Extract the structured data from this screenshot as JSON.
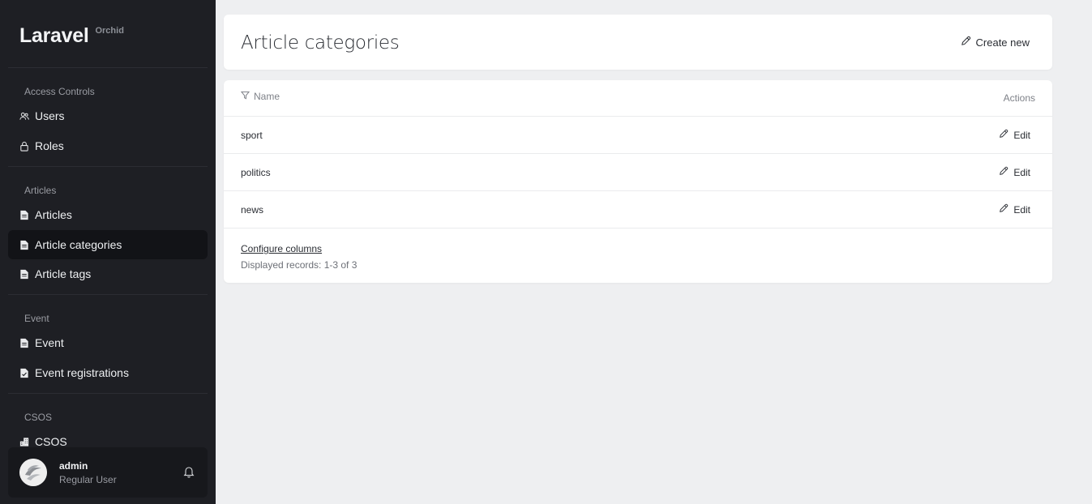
{
  "sidebar": {
    "brand": {
      "name": "Laravel",
      "sub": "Orchid"
    },
    "sections": [
      {
        "title": "Access Controls",
        "items": [
          {
            "label": "Users",
            "icon": "users-icon"
          },
          {
            "label": "Roles",
            "icon": "lock-icon"
          }
        ]
      },
      {
        "title": "Articles",
        "items": [
          {
            "label": "Articles",
            "icon": "document-icon"
          },
          {
            "label": "Article categories",
            "icon": "document-icon",
            "active": true
          },
          {
            "label": "Article tags",
            "icon": "document-icon"
          }
        ]
      },
      {
        "title": "Event",
        "items": [
          {
            "label": "Event",
            "icon": "document-icon"
          },
          {
            "label": "Event registrations",
            "icon": "document-check-icon"
          }
        ]
      },
      {
        "title": "CSOS",
        "items": [
          {
            "label": "CSOS",
            "icon": "building-icon"
          }
        ]
      }
    ],
    "user": {
      "name": "admin",
      "role": "Regular User"
    }
  },
  "header": {
    "title": "Article categories",
    "create_label": "Create new"
  },
  "table": {
    "columns": {
      "name": "Name",
      "actions": "Actions"
    },
    "rows": [
      {
        "name": "sport",
        "action": "Edit"
      },
      {
        "name": "politics",
        "action": "Edit"
      },
      {
        "name": "news",
        "action": "Edit"
      }
    ],
    "configure_label": "Configure columns",
    "records_label": "Displayed records: 1-3 of 3"
  },
  "colors": {
    "sidebar_bg": "#1e1f24",
    "active_item_bg": "#121317",
    "page_bg": "#eeeff1",
    "card_bg": "#ffffff"
  }
}
